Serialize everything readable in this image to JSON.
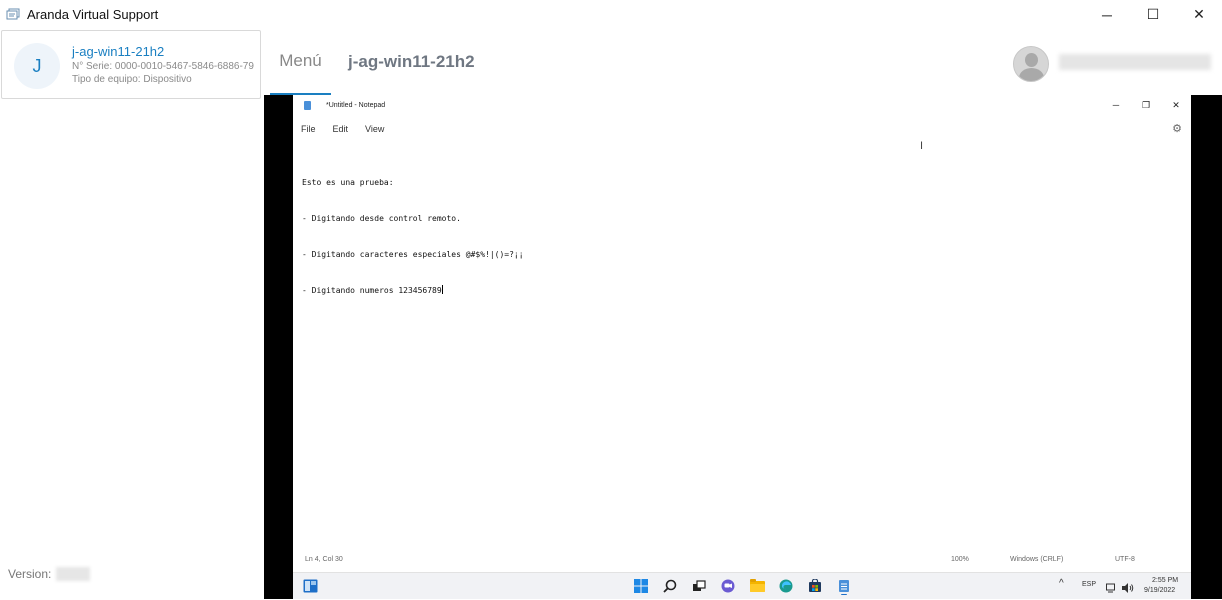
{
  "window": {
    "title": "Aranda Virtual Support",
    "minimize_glyph": "─",
    "maximize_glyph": "☐",
    "close_glyph": "✕"
  },
  "sidebar": {
    "device": {
      "initial": "J",
      "name": "j-ag-win11-21h2",
      "serial": "N° Serie: 0000-0010-5467-5846-6886-79",
      "type": "Tipo de equipo: Dispositivo"
    },
    "version_label": "Version:"
  },
  "header": {
    "menu_tab": "Menú",
    "device_name": "j-ag-win11-21h2"
  },
  "notepad": {
    "title": "*Untitled - Notepad",
    "controls": {
      "minimize": "─",
      "restore": "❐",
      "close": "✕"
    },
    "menus": [
      "File",
      "Edit",
      "View"
    ],
    "settings_glyph": "⚙",
    "lines": [
      "Esto es una prueba:",
      "- Digitando desde control remoto.",
      "- Digitando caracteres especiales @#$%!|()=?¡¡",
      "- Digitando numeros 123456789"
    ],
    "status": {
      "position": "Ln 4, Col 30",
      "zoom": "100%",
      "line_ending": "Windows (CRLF)",
      "encoding": "UTF-8"
    }
  },
  "taskbar": {
    "language": "ESP",
    "time": "2:55 PM",
    "date": "9/19/2022",
    "chevron": "^"
  },
  "icons": {
    "accent": "#1a7fc1",
    "windows_blue": "#1e88e5"
  }
}
